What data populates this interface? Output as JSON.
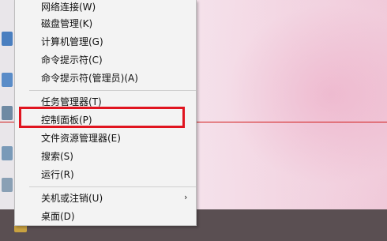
{
  "menu": {
    "items": [
      {
        "label": "网络连接(W)"
      },
      {
        "label": "磁盘管理(K)"
      },
      {
        "label": "计算机管理(G)"
      },
      {
        "label": "命令提示符(C)"
      },
      {
        "label": "命令提示符(管理员)(A)"
      },
      {
        "label": "任务管理器(T)"
      },
      {
        "label": "控制面板(P)"
      },
      {
        "label": "文件资源管理器(E)"
      },
      {
        "label": "搜索(S)"
      },
      {
        "label": "运行(R)"
      },
      {
        "label": "关机或注销(U)"
      },
      {
        "label": "桌面(D)"
      }
    ],
    "submenu_arrow": "›",
    "highlighted_item": "控制面板(P)"
  },
  "colors": {
    "highlight_border": "#e0141f",
    "menu_background": "#f3f3f3",
    "taskbar": "#5a4f52",
    "guide_line": "#d21b1b"
  }
}
